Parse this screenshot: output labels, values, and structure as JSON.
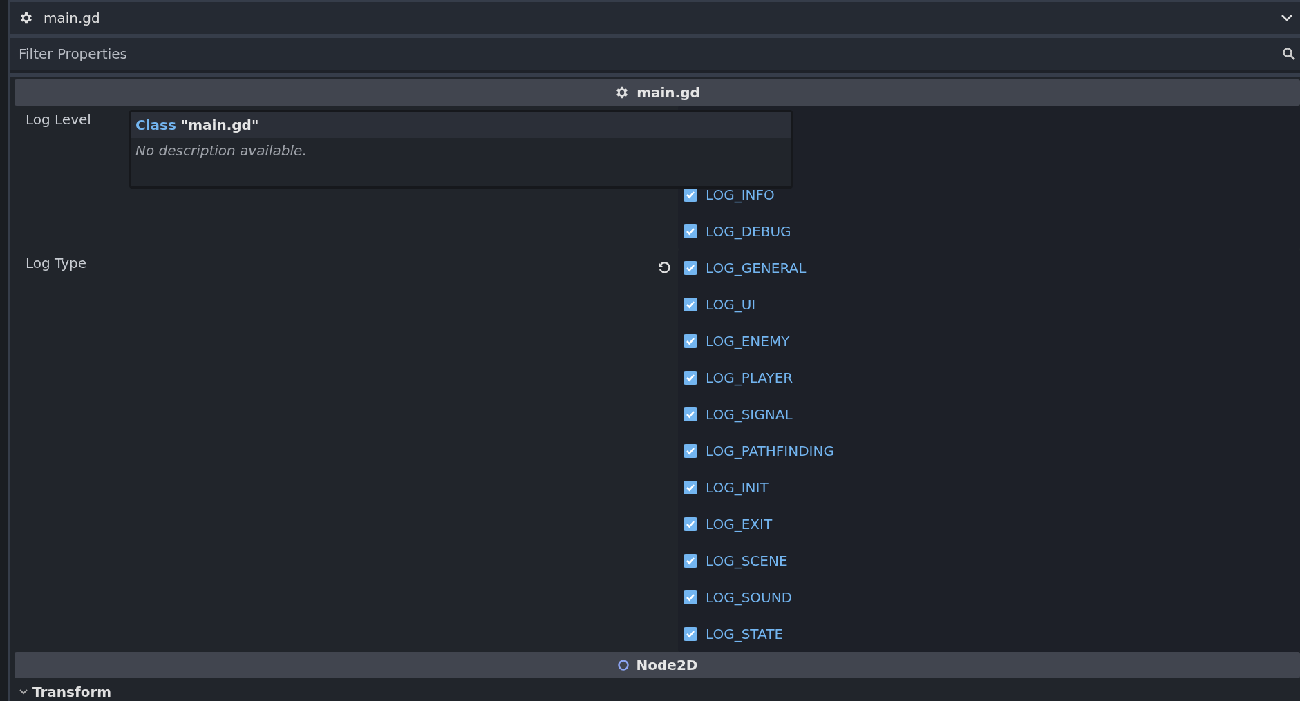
{
  "script_bar": {
    "title": "main.gd"
  },
  "filter": {
    "placeholder": "Filter Properties"
  },
  "script_section": {
    "title": "main.gd"
  },
  "properties": [
    {
      "label": "Log Level",
      "revertable": false,
      "flags": [
        {
          "name": "LOG_INFO",
          "checked": true
        },
        {
          "name": "LOG_DEBUG",
          "checked": true
        }
      ]
    },
    {
      "label": "Log Type",
      "revertable": true,
      "flags": [
        {
          "name": "LOG_GENERAL",
          "checked": true
        },
        {
          "name": "LOG_UI",
          "checked": true
        },
        {
          "name": "LOG_ENEMY",
          "checked": true
        },
        {
          "name": "LOG_PLAYER",
          "checked": true
        },
        {
          "name": "LOG_SIGNAL",
          "checked": true
        },
        {
          "name": "LOG_PATHFINDING",
          "checked": true
        },
        {
          "name": "LOG_INIT",
          "checked": true
        },
        {
          "name": "LOG_EXIT",
          "checked": true
        },
        {
          "name": "LOG_SCENE",
          "checked": true
        },
        {
          "name": "LOG_SOUND",
          "checked": true
        },
        {
          "name": "LOG_STATE",
          "checked": true
        }
      ]
    }
  ],
  "tooltip": {
    "title": "**Class** \"main.gd\"",
    "description": "No description available."
  },
  "node_section": {
    "title": "Node2D"
  },
  "groups": [
    {
      "title": "Transform",
      "expanded": true
    }
  ]
}
